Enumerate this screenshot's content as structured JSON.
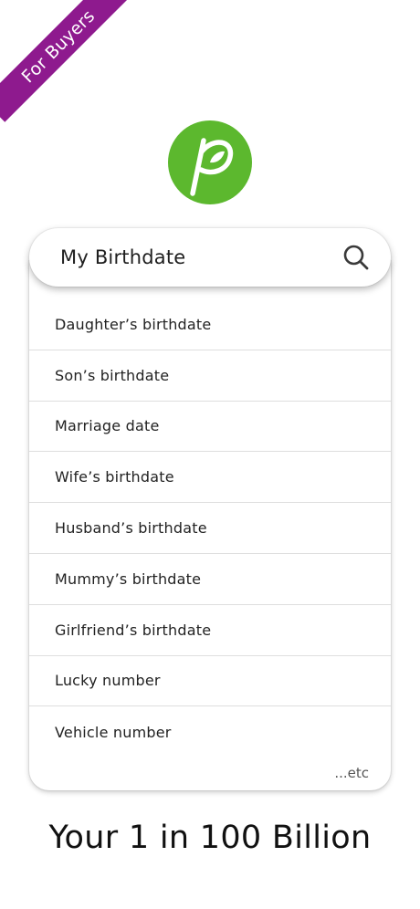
{
  "ribbon": {
    "label": "For Buyers",
    "color": "#8e1a8e"
  },
  "logo": {
    "icon": "leaf-p-logo-icon",
    "color": "#5cb82e"
  },
  "search": {
    "value": "My Birthdate",
    "icon": "search-icon"
  },
  "suggestions": {
    "items": [
      {
        "label": "Daughter’s birthdate"
      },
      {
        "label": "Son’s birthdate"
      },
      {
        "label": "Marriage date"
      },
      {
        "label": "Wife’s birthdate"
      },
      {
        "label": "Husband’s birthdate"
      },
      {
        "label": "Mummy’s birthdate"
      },
      {
        "label": "Girlfriend’s birthdate"
      },
      {
        "label": "Lucky number"
      },
      {
        "label": "Vehicle number"
      }
    ],
    "more_label": "...etc"
  },
  "tagline": "Your 1 in 100 Billion"
}
